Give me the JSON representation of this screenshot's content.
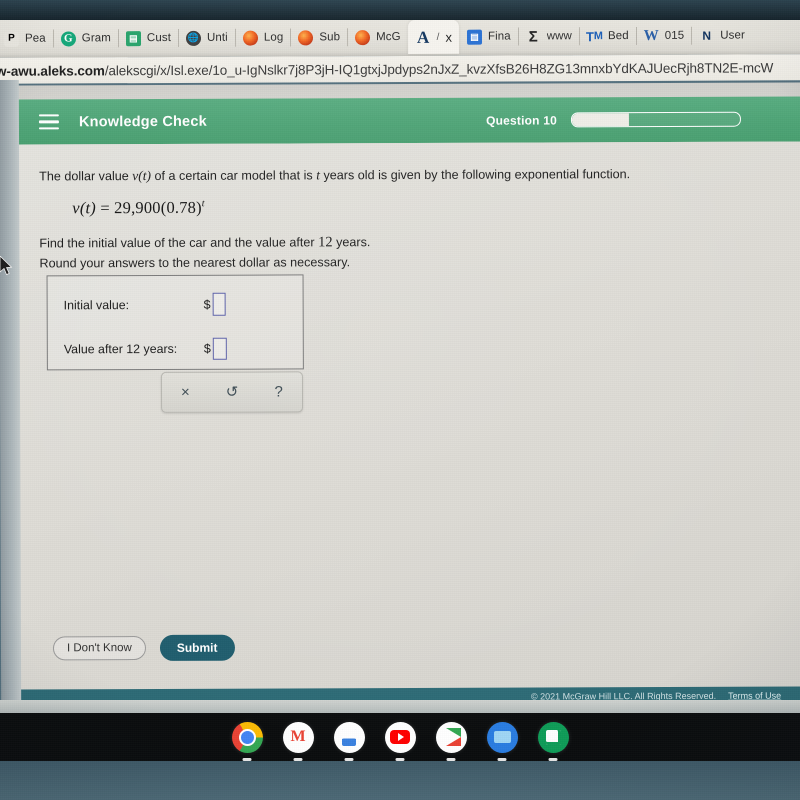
{
  "browser": {
    "tabs": [
      {
        "label": "Pea",
        "icon": "pearson-icon"
      },
      {
        "label": "Gram",
        "icon": "grammarly-icon"
      },
      {
        "label": "Cust",
        "icon": "custom-app-icon"
      },
      {
        "label": "Unti",
        "icon": "globe-icon"
      },
      {
        "label": "Log",
        "icon": "firefox-icon"
      },
      {
        "label": "Sub",
        "icon": "firefox-icon"
      },
      {
        "label": "McG",
        "icon": "firefox-icon"
      },
      {
        "label": "x",
        "icon": "letter-a-icon"
      },
      {
        "label": "Fina",
        "icon": "document-icon"
      },
      {
        "label": "www",
        "icon": "sigma-icon"
      },
      {
        "label": "Bed",
        "icon": "tm-icon"
      },
      {
        "label": "015",
        "icon": "word-icon"
      },
      {
        "label": "User",
        "icon": "nb-icon"
      }
    ],
    "url_host": "w-awu.aleks.com",
    "url_path": "/alekscgi/x/Isl.exe/1o_u-IgNslkr7j8P3jH-IQ1gtxjJpdyps2nJxZ_kvzXfsB26H8ZG13mnxbYdKAJUecRjh8TN2E-mcW"
  },
  "header": {
    "menu_icon": "hamburger-icon",
    "title": "Knowledge Check",
    "question_label": "Question 10",
    "progress_percent": 34,
    "bg_color": "#4fa577"
  },
  "question": {
    "prompt_prefix": "The dollar value",
    "prompt_var1": "v",
    "prompt_arg1": "(t)",
    "prompt_mid": "of a certain car model that is",
    "prompt_var2": "t",
    "prompt_suffix": "years old is given by the following exponential function.",
    "equation_left": "v",
    "equation_arg": "(t)",
    "equation_eq": "= 29,900",
    "equation_base": "(0.78)",
    "equation_exponent": "t",
    "instruction_line1_a": "Find the initial value of the car and the value after",
    "instruction_years": "12",
    "instruction_line1_b": "years.",
    "instruction_line2": "Round your answers to the nearest dollar as necessary."
  },
  "answers": {
    "row1_label": "Initial value:",
    "row1_currency": "$",
    "row1_value": "",
    "row1_placeholder": "",
    "row2_label": "Value after 12 years:",
    "row2_currency": "$",
    "row2_value": "",
    "row2_placeholder": ""
  },
  "math_toolbar": {
    "clear_label": "×",
    "undo_label": "↺",
    "help_label": "?"
  },
  "actions": {
    "dont_know_label": "I Don't Know",
    "submit_label": "Submit",
    "submit_color": "#1f5d6e"
  },
  "footer": {
    "copyright": "© 2021 McGraw Hill LLC. All Rights Reserved.",
    "terms_link": "Terms of Use",
    "bg_color": "#2d6b76"
  },
  "taskbar": {
    "apps": [
      {
        "name": "chrome-icon",
        "label": ""
      },
      {
        "name": "gmail-icon",
        "label": "M"
      },
      {
        "name": "google-docs-icon",
        "label": ""
      },
      {
        "name": "youtube-icon",
        "label": ""
      },
      {
        "name": "play-store-icon",
        "label": ""
      },
      {
        "name": "files-icon",
        "label": ""
      },
      {
        "name": "google-sheets-icon",
        "label": ""
      }
    ]
  }
}
